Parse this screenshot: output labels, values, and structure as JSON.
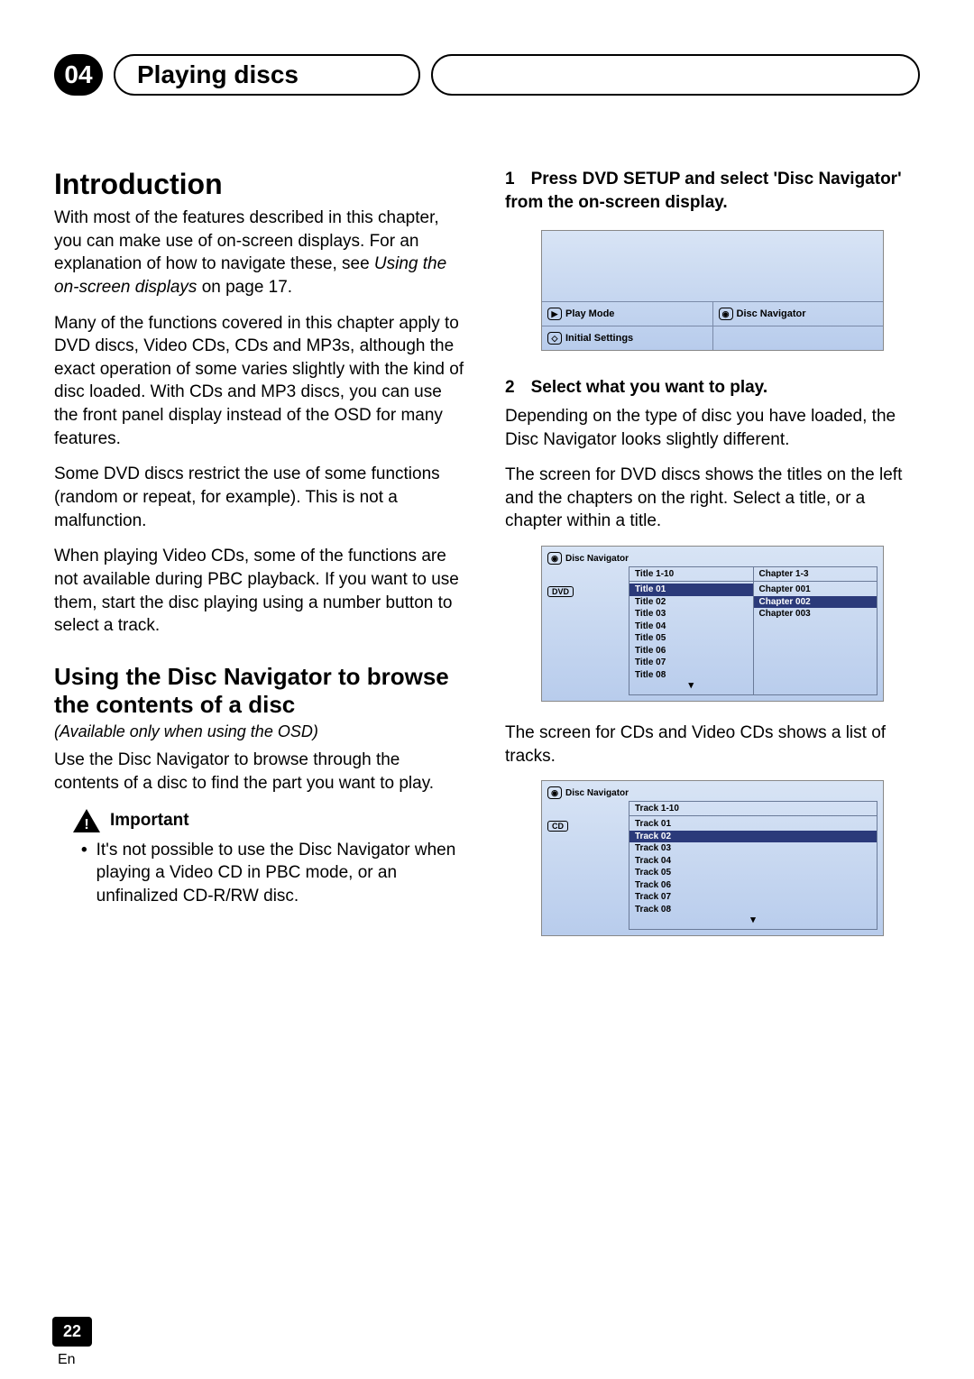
{
  "header": {
    "chapter_num": "04",
    "chapter_title": "Playing discs"
  },
  "left": {
    "h1": "Introduction",
    "p1a": "With most of the features described in this chapter, you can make use of on-screen displays. For an explanation of how to navigate these, see ",
    "p1b": "Using the on-screen displays",
    "p1c": " on page 17.",
    "p2": "Many of the functions covered in this chapter apply to DVD discs, Video CDs, CDs and MP3s, although the exact operation of some varies slightly with the kind of disc loaded. With CDs and MP3 discs, you can use the front panel display instead of the OSD for many features.",
    "p3": "Some DVD discs restrict the use of some functions (random or repeat, for example). This is not a malfunction.",
    "p4": "When playing Video CDs, some of the functions are not available during PBC playback. If you want to use them, start the disc playing using a number button to select a track.",
    "h2": "Using the Disc Navigator to browse the contents of a disc",
    "subnote": "(Available only when using the OSD)",
    "p5": "Use the Disc Navigator to browse through the contents of a disc to find the part you want to play.",
    "important": "Important",
    "bullet1": "It's not possible to use the Disc Navigator when playing a Video CD in PBC mode, or an unfinalized CD-R/RW disc."
  },
  "right": {
    "step1_num": "1",
    "step1": "Press DVD SETUP and select 'Disc Navigator' from the on-screen display.",
    "osd1": {
      "play_mode": "Play Mode",
      "disc_nav": "Disc Navigator",
      "initial": "Initial Settings"
    },
    "step2_num": "2",
    "step2": "Select what you want to play.",
    "p6": "Depending on the type of disc you have loaded, the Disc Navigator looks slightly different.",
    "p7": "The screen for DVD discs shows the titles on the left and the chapters on the right. Select a title, or a chapter within a title.",
    "osd2": {
      "title": "Disc Navigator",
      "badge": "DVD",
      "col1_head": "Title 1-10",
      "col2_head": "Chapter 1-3",
      "titles": [
        "Title 01",
        "Title 02",
        "Title 03",
        "Title 04",
        "Title 05",
        "Title 06",
        "Title 07",
        "Title 08"
      ],
      "chapters": [
        "Chapter 001",
        "Chapter 002",
        "Chapter 003"
      ]
    },
    "p8": "The screen for CDs and Video CDs shows a list of tracks.",
    "osd3": {
      "title": "Disc Navigator",
      "badge": "CD",
      "col_head": "Track 1-10",
      "tracks": [
        "Track 01",
        "Track 02",
        "Track 03",
        "Track 04",
        "Track 05",
        "Track 06",
        "Track 07",
        "Track 08"
      ]
    }
  },
  "footer": {
    "page": "22",
    "lang": "En"
  }
}
